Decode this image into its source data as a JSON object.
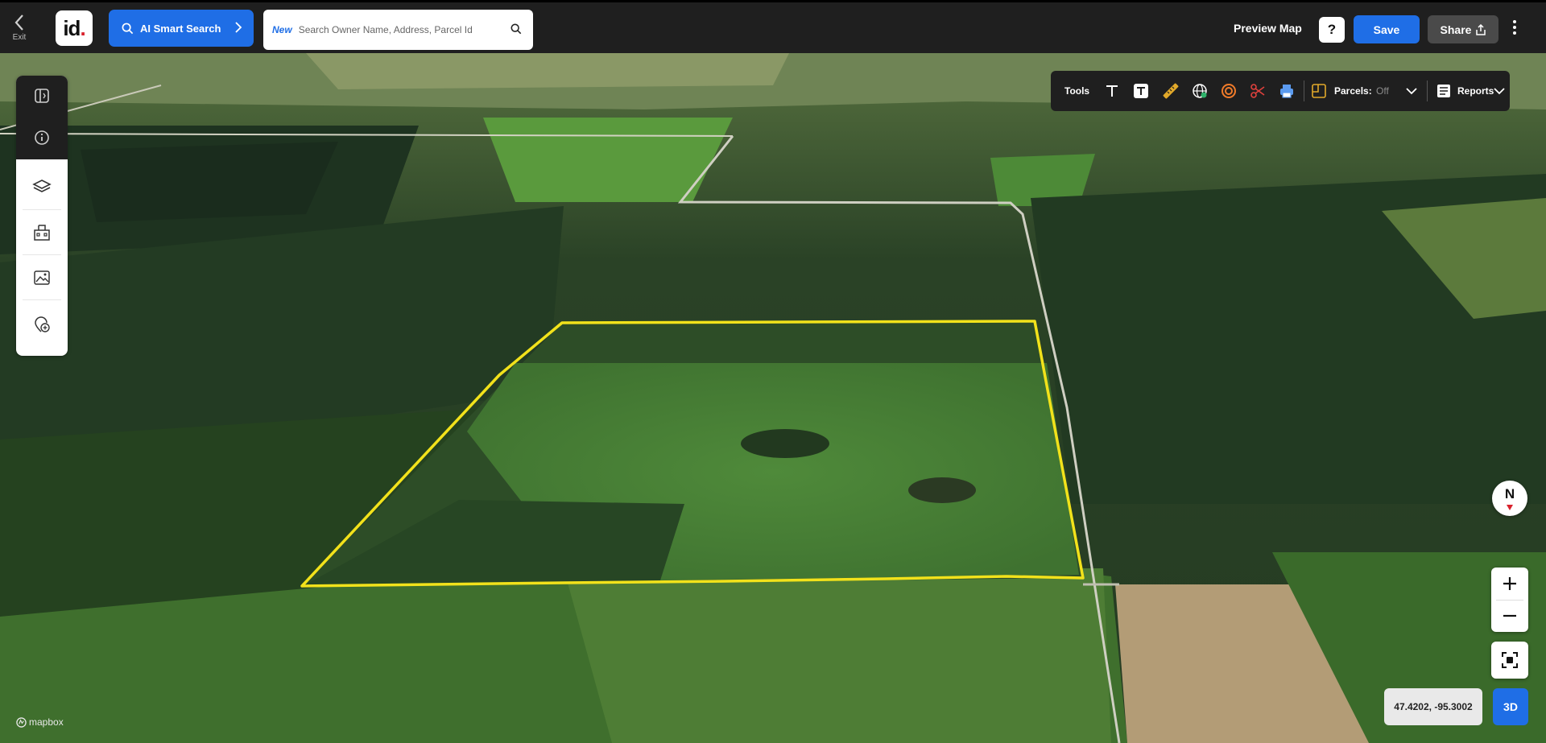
{
  "header": {
    "exit_label": "Exit",
    "logo_text": "id",
    "ai_search_label": "AI Smart Search",
    "search_badge": "New",
    "search_placeholder": "Search Owner Name, Address, Parcel Id",
    "preview_label": "Preview Map",
    "help_label": "?",
    "save_label": "Save",
    "share_label": "Share"
  },
  "tools": {
    "label": "Tools",
    "parcels_label": "Parcels:",
    "parcels_state": "Off",
    "reports_label": "Reports"
  },
  "map": {
    "compass_label": "N",
    "coordinates": "47.4202, -95.3002",
    "view_mode": "3D",
    "attribution": "mapbox",
    "parcel_outline_color": "#f2e21b"
  },
  "colors": {
    "accent": "#1f6ee6",
    "header_bg": "#1f1f1f"
  }
}
